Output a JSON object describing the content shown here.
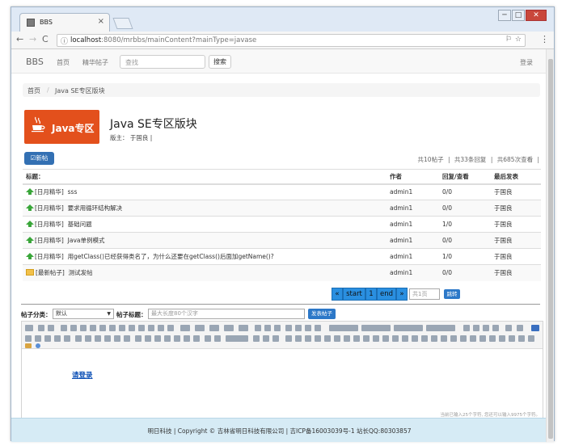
{
  "browser": {
    "tab_title": "BBS",
    "url_host": "localhost",
    "url_rest": ":8080/mrbbs/mainContent?mainType=javase",
    "min": "─",
    "max": "□",
    "close": "✕"
  },
  "navbar": {
    "brand": "BBS",
    "home": "首页",
    "featured": "精华帖子",
    "search_placeholder": "查找",
    "search_button": "搜索",
    "login": "登录"
  },
  "breadcrumb": {
    "home": "首页",
    "sep": "/",
    "current": "Java SE专区版块"
  },
  "section": {
    "banner_text": "Java专区",
    "title": "Java SE专区版块",
    "moderator": "版主： 于国良 |",
    "new_post_button": "☑新帖",
    "stats": {
      "posts": "共10帖子",
      "replies": "共33条回复",
      "views": "共685次查看",
      "sep": "|"
    }
  },
  "table": {
    "headers": [
      "标题：",
      "作者",
      "回复/查看",
      "最后发表"
    ],
    "rows": [
      {
        "tag": "[日月精华]",
        "title": "sss",
        "author": "admin1",
        "rv": "0/0",
        "last": "于国良",
        "icon": "up-arrow"
      },
      {
        "tag": "[日月精华]",
        "title": "要求用循环结构解决",
        "author": "admin1",
        "rv": "0/0",
        "last": "于国良",
        "icon": "up-arrow"
      },
      {
        "tag": "[日月精华]",
        "title": "基础问题",
        "author": "admin1",
        "rv": "1/0",
        "last": "于国良",
        "icon": "up-arrow"
      },
      {
        "tag": "[日月精华]",
        "title": "Java单例模式",
        "author": "admin1",
        "rv": "0/0",
        "last": "于国良",
        "icon": "up-arrow"
      },
      {
        "tag": "[日月精华]",
        "title": "用getClass()已经获得类名了，为什么还要在getClass()后面加getName()?",
        "author": "admin1",
        "rv": "1/0",
        "last": "于国良",
        "icon": "up-arrow"
      },
      {
        "tag": "[最新帖子]",
        "title": "测试发帖",
        "author": "admin1",
        "rv": "0/0",
        "last": "于国良",
        "icon": "folder"
      }
    ]
  },
  "pager": {
    "prev": "«",
    "start": "start",
    "page": "1",
    "end": "end",
    "next": "»",
    "input_placeholder": "共1页",
    "jump": "跳转"
  },
  "form": {
    "category_label": "帖子分类：",
    "category_value": "默认",
    "caret": "▼",
    "title_label": "帖子标题：",
    "title_placeholder": "最大长度80个汉字",
    "submit": "发表帖子"
  },
  "editor": {
    "link_text": "请登录",
    "counter": "当前已输入25个字符, 您还可以输入9975个字符。"
  },
  "footer": {
    "text": "明日科技 | Copyright © 吉林省明日科技有限公司 | 吉ICP备16003039号-1 站长QQ:80303857"
  },
  "colors": {
    "primary": "#3370b3",
    "pager": "#2a8fe0",
    "banner": "#e3501c",
    "footer": "#d6ebf5"
  }
}
